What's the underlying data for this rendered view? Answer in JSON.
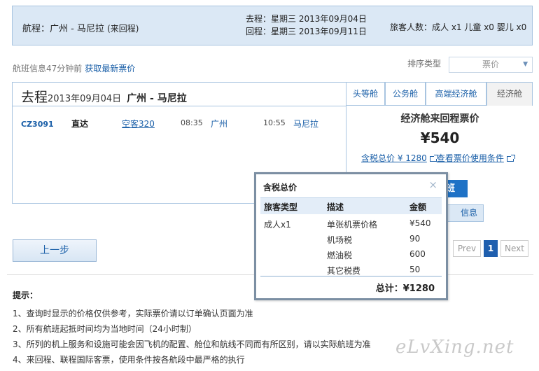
{
  "trip": {
    "route_label": "航程：",
    "route": "广州 - 马尼拉",
    "route_note": "(来回程)",
    "depart_label": "去程：",
    "depart_value": "星期三 2013年09月04日",
    "return_label": "回程：",
    "return_value": "星期三 2013年09月11日",
    "pax_label": "旅客人数：",
    "pax_value": "成人 x1 儿童 x0 婴儿 x0"
  },
  "info": {
    "text": "航班信息47分钟前",
    "refresh_link": "获取最新票价"
  },
  "sort": {
    "label": "排序类型",
    "value": "票价"
  },
  "panel": {
    "title": "去程",
    "date": "2013年09月04日",
    "route": "广州 - 马尼拉",
    "tabs": [
      "头等舱",
      "公务舱",
      "高端经济舱",
      "经济舱"
    ]
  },
  "flight": {
    "number": "CZ3091",
    "type": "直达",
    "aircraft": "空客320",
    "depart_time": "08:35",
    "depart_city": "广州",
    "arrive_time": "10:55",
    "arrive_city": "马尼拉"
  },
  "fare": {
    "title": "经济舱来回程票价",
    "price": "¥540",
    "tax_link": "含税总价 ¥ 1280",
    "terms_link": "查看票价使用条件",
    "select_button": "班",
    "info_tab": "信息"
  },
  "popup": {
    "title": "含税总价",
    "close": "×",
    "headers": [
      "旅客类型",
      "描述",
      "金额"
    ],
    "rows": [
      {
        "pax": "成人x1",
        "desc": "单张机票价格",
        "amount": "¥540"
      },
      {
        "pax": "",
        "desc": "机场税",
        "amount": "90"
      },
      {
        "pax": "",
        "desc": "燃油税",
        "amount": "600"
      },
      {
        "pax": "",
        "desc": "其它税费",
        "amount": "50"
      }
    ],
    "total": "总计：¥1280"
  },
  "nav": {
    "back": "上一步",
    "prev": "Prev",
    "page": "1",
    "next": "Next"
  },
  "tips": {
    "title": "提示：",
    "items": [
      "1、查询时显示的价格仅供参考，实际票价请以订单确认页面为准",
      "2、所有航班起抵时间均为当地时间（24小时制）",
      "3、所列的机上服务和设施可能会因飞机的配置、舱位和航线不同而有所区别，请以实际航班为准",
      "4、来回程、联程国际客票，使用条件按各航段中最严格的执行"
    ]
  },
  "watermark": "eLvXing.net"
}
